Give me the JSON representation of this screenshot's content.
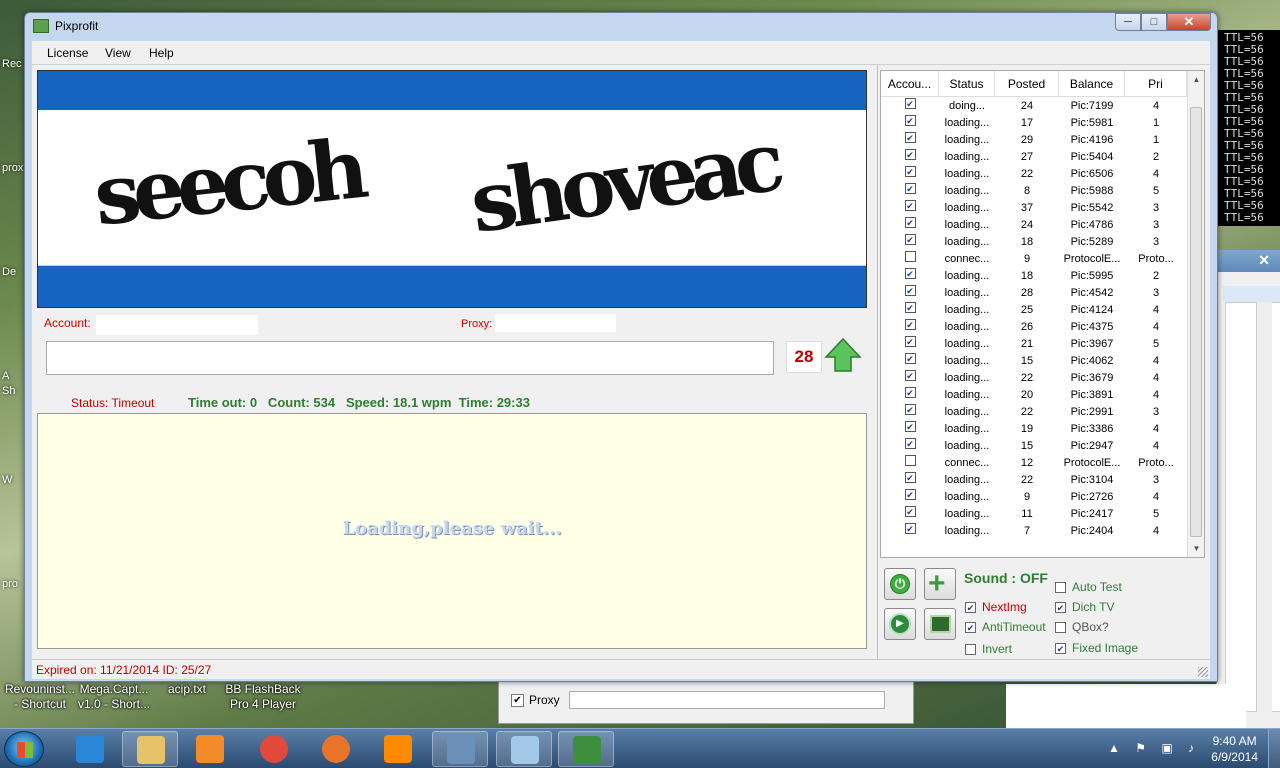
{
  "window": {
    "title": "Pixprofit",
    "minimize": "─",
    "maximize": "□",
    "close": "✕"
  },
  "menu": [
    "License",
    "View",
    "Help"
  ],
  "captcha": {
    "word1": "seecoh",
    "word2": "shoveac"
  },
  "account": {
    "label": "Account:",
    "value": ""
  },
  "proxy": {
    "label": "Proxy:",
    "value": ""
  },
  "answer": {
    "value": ""
  },
  "counter": "28",
  "status": {
    "text": "Status: Timeout",
    "stats": "Time out: 0   Count: 534   Speed: 18.1 wpm  Time: 29:33"
  },
  "loading": "Loading,please wait...",
  "grid": {
    "columns": [
      "Accou...",
      "Status",
      "Posted",
      "Balance",
      "Pri"
    ],
    "rows": [
      {
        "checked": true,
        "status": "doing...",
        "posted": "24",
        "balance": "Pic:7199",
        "pri": "4"
      },
      {
        "checked": true,
        "status": "loading...",
        "posted": "17",
        "balance": "Pic:5981",
        "pri": "1"
      },
      {
        "checked": true,
        "status": "loading...",
        "posted": "29",
        "balance": "Pic:4196",
        "pri": "1"
      },
      {
        "checked": true,
        "status": "loading...",
        "posted": "27",
        "balance": "Pic:5404",
        "pri": "2"
      },
      {
        "checked": true,
        "status": "loading...",
        "posted": "22",
        "balance": "Pic:6506",
        "pri": "4"
      },
      {
        "checked": true,
        "status": "loading...",
        "posted": "8",
        "balance": "Pic:5988",
        "pri": "5"
      },
      {
        "checked": true,
        "status": "loading...",
        "posted": "37",
        "balance": "Pic:5542",
        "pri": "3"
      },
      {
        "checked": true,
        "status": "loading...",
        "posted": "24",
        "balance": "Pic:4786",
        "pri": "3"
      },
      {
        "checked": true,
        "status": "loading...",
        "posted": "18",
        "balance": "Pic:5289",
        "pri": "3"
      },
      {
        "checked": false,
        "status": "connec...",
        "posted": "9",
        "balance": "ProtocolE...",
        "pri": "Proto..."
      },
      {
        "checked": true,
        "status": "loading...",
        "posted": "18",
        "balance": "Pic:5995",
        "pri": "2"
      },
      {
        "checked": true,
        "status": "loading...",
        "posted": "28",
        "balance": "Pic:4542",
        "pri": "3"
      },
      {
        "checked": true,
        "status": "loading...",
        "posted": "25",
        "balance": "Pic:4124",
        "pri": "4"
      },
      {
        "checked": true,
        "status": "loading...",
        "posted": "26",
        "balance": "Pic:4375",
        "pri": "4"
      },
      {
        "checked": true,
        "status": "loading...",
        "posted": "21",
        "balance": "Pic:3967",
        "pri": "5"
      },
      {
        "checked": true,
        "status": "loading...",
        "posted": "15",
        "balance": "Pic:4062",
        "pri": "4"
      },
      {
        "checked": true,
        "status": "loading...",
        "posted": "22",
        "balance": "Pic:3679",
        "pri": "4"
      },
      {
        "checked": true,
        "status": "loading...",
        "posted": "20",
        "balance": "Pic:3891",
        "pri": "4"
      },
      {
        "checked": true,
        "status": "loading...",
        "posted": "22",
        "balance": "Pic:2991",
        "pri": "3"
      },
      {
        "checked": true,
        "status": "loading...",
        "posted": "19",
        "balance": "Pic:3386",
        "pri": "4"
      },
      {
        "checked": true,
        "status": "loading...",
        "posted": "15",
        "balance": "Pic:2947",
        "pri": "4"
      },
      {
        "checked": false,
        "status": "connec...",
        "posted": "12",
        "balance": "ProtocolE...",
        "pri": "Proto..."
      },
      {
        "checked": true,
        "status": "loading...",
        "posted": "22",
        "balance": "Pic:3104",
        "pri": "3"
      },
      {
        "checked": true,
        "status": "loading...",
        "posted": "9",
        "balance": "Pic:2726",
        "pri": "4"
      },
      {
        "checked": true,
        "status": "loading...",
        "posted": "11",
        "balance": "Pic:2417",
        "pri": "5"
      },
      {
        "checked": true,
        "status": "loading...",
        "posted": "7",
        "balance": "Pic:2404",
        "pri": "4"
      }
    ]
  },
  "controls": {
    "sound": "Sound : OFF",
    "options": [
      {
        "key": "nextimg",
        "label": "NextImg",
        "checked": true,
        "color": "red"
      },
      {
        "key": "antitimeout",
        "label": "AntiTimeout",
        "checked": true,
        "color": "green"
      },
      {
        "key": "invert",
        "label": "Invert",
        "checked": false,
        "color": "green"
      },
      {
        "key": "autotest",
        "label": "Auto Test",
        "checked": false,
        "color": "green"
      },
      {
        "key": "dichtv",
        "label": "Dich TV",
        "checked": true,
        "color": "green"
      },
      {
        "key": "qbox",
        "label": "QBox?",
        "checked": false,
        "color": "gray"
      },
      {
        "key": "fixedimage",
        "label": "Fixed Image",
        "checked": true,
        "color": "green"
      }
    ]
  },
  "statusbar": "Expired on: 11/21/2014  ID: 25/27",
  "console_lines": [
    "TTL=56",
    "TTL=56",
    "TTL=56",
    "TTL=56",
    "TTL=56",
    "TTL=56",
    "TTL=56",
    "TTL=56",
    "TTL=56",
    "TTL=56",
    "TTL=56",
    "TTL=56",
    "TTL=56",
    "TTL=56",
    "TTL=56",
    "TTL=56"
  ],
  "desktop": {
    "left_fragments": [
      "Rec",
      "prox",
      "De",
      "A",
      "Sh",
      "W",
      "pro"
    ],
    "icons": [
      {
        "line1": "Revouninst...",
        "line2": "- Shortcut"
      },
      {
        "line1": "Mega.Capt...",
        "line2": "v1.0 - Short..."
      },
      {
        "line1": "acip.txt",
        "line2": ""
      },
      {
        "line1": "BB FlashBack",
        "line2": "Pro 4 Player"
      }
    ],
    "dialog_proxy_label": "Proxy"
  },
  "taskbar": {
    "time": "9:40 AM",
    "date": "6/9/2014",
    "items": [
      {
        "icon": "internet-explorer-icon",
        "color": "#2a86d6"
      },
      {
        "icon": "file-explorer-icon",
        "color": "#e6c36a"
      },
      {
        "icon": "media-player-icon",
        "color": "#f28c28"
      },
      {
        "icon": "chrome-icon",
        "color": "#e04a3b"
      },
      {
        "icon": "firefox-icon",
        "color": "#e8742a"
      },
      {
        "icon": "vlc-icon",
        "color": "#ff8a00"
      },
      {
        "icon": "window-app-icon",
        "color": "#6a8fb8"
      },
      {
        "icon": "notepad-icon",
        "color": "#a4c8e8"
      },
      {
        "icon": "code-app-icon",
        "color": "#3d8f3d"
      }
    ]
  }
}
